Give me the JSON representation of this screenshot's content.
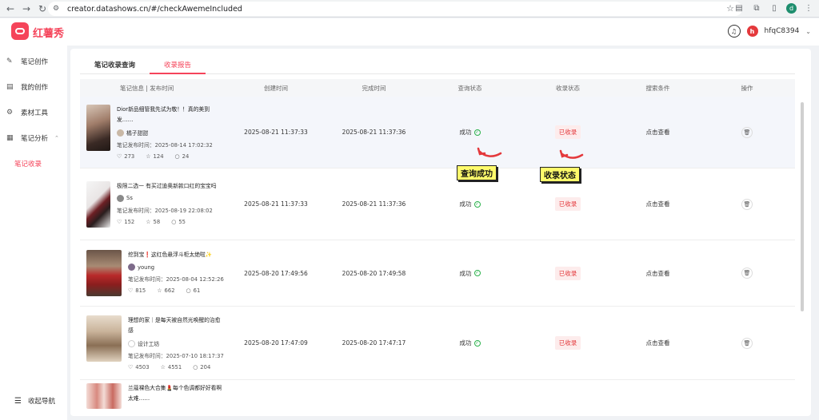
{
  "browser": {
    "url": "creator.datashows.cn/#/checkAwemeIncluded",
    "profile_initial": "d"
  },
  "header": {
    "app_name": "红薯秀",
    "user_initial": "h",
    "username": "hfqC8394"
  },
  "sidebar": {
    "items": [
      {
        "label": "笔记创作",
        "icon": "pen-icon"
      },
      {
        "label": "我的创作",
        "icon": "document-icon"
      },
      {
        "label": "素材工具",
        "icon": "gear-icon"
      },
      {
        "label": "笔记分析",
        "icon": "chart-icon"
      },
      {
        "label": "笔记收录",
        "icon": ""
      }
    ],
    "collapse_label": "收起导航"
  },
  "tabs": [
    "笔记收录查询",
    "收录报告"
  ],
  "table": {
    "columns": [
      "笔记信息 | 发布时间",
      "创建时间",
      "完成时间",
      "查询状态",
      "收录状态",
      "搜索条件",
      "操作"
    ],
    "rows": [
      {
        "title": "Dior新品细管我先试为敬！！真的美到发……",
        "author": "橘子甜甜",
        "pub_time": "笔记发布时间：2025-08-14 17:02:32",
        "likes": "273",
        "collects": "124",
        "comments": "24",
        "created": "2025-08-21 11:37:33",
        "finished": "2025-08-21 11:37:36",
        "query_status": "成功",
        "include_status": "已收录",
        "search": "点击查看"
      },
      {
        "title": "极限二选一 有买过迪奥新款口红的宝宝吗",
        "author": "Ss",
        "pub_time": "笔记发布时间：2025-08-19 22:08:02",
        "likes": "152",
        "collects": "58",
        "comments": "55",
        "created": "2025-08-21 11:37:33",
        "finished": "2025-08-21 11:37:36",
        "query_status": "成功",
        "include_status": "已收录",
        "search": "点击查看"
      },
      {
        "title": "挖到宝❗这红色悬浮斗柜太绝啦✨",
        "author": "young",
        "pub_time": "笔记发布时间：2025-08-04 12:52:26",
        "likes": "815",
        "collects": "662",
        "comments": "61",
        "created": "2025-08-20 17:49:56",
        "finished": "2025-08-20 17:49:58",
        "query_status": "成功",
        "include_status": "已收录",
        "search": "点击查看"
      },
      {
        "title": "理想的家｜是每天被自然光唤醒的治愈感",
        "author": "设计工坊",
        "pub_time": "笔记发布时间：2025-07-10 18:17:37",
        "likes": "4503",
        "collects": "4551",
        "comments": "204",
        "created": "2025-08-20 17:47:09",
        "finished": "2025-08-20 17:47:17",
        "query_status": "成功",
        "include_status": "已收录",
        "search": "点击查看"
      },
      {
        "title": "兰蔻裸色大合集💄每个色调都好好看啊太难……"
      }
    ]
  },
  "annotations": {
    "query_success": "查询成功",
    "include_status": "收录状态"
  },
  "colors": {
    "accent": "#f5445a",
    "success": "#2bb24c",
    "badge_bg": "#fdecec",
    "badge_text": "#e4393c",
    "highlight_row": "#f4f6fb",
    "callout_bg": "#fffb6b"
  }
}
